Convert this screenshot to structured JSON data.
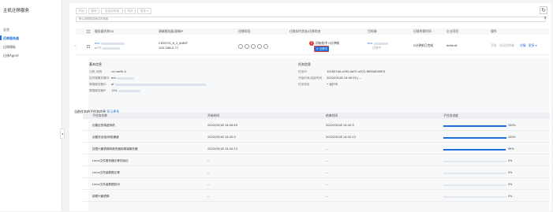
{
  "sidebar": {
    "title": "主机迁移服务",
    "items": [
      {
        "label": "总览",
        "active": false
      },
      {
        "label": "迁移服务器",
        "active": true
      },
      {
        "label": "迁移模板",
        "active": false
      },
      {
        "label": "迁移Agent",
        "active": false
      }
    ]
  },
  "toolbar": {
    "buttons": [
      "开始",
      "暂停",
      "启动目的端",
      "同步",
      "更多 ▾"
    ],
    "search_placeholder": "默认按照服务器名称搜索"
  },
  "table": {
    "headers": [
      "服务器名称/ID",
      "源端服务器/源端IP",
      "迁移阶段",
      "迁移实时状态/迁移状态",
      "目的端",
      "迁移所需时间",
      "企业项目",
      "操作"
    ],
    "row": {
      "name_prefix": "ecs",
      "name_id_prefix": "af73",
      "os": "CENTOS_6_2_64BIT",
      "ip": "192.168.0.77",
      "status": "初始化中 0分钟前",
      "status_badge": "迁移中",
      "target_prefix": "ecs",
      "target_sub": "迁移中",
      "time": "0分钟前已完成",
      "project": "default",
      "actions": [
        "开始",
        "启动目的端",
        "详情",
        "更多 ▾"
      ]
    }
  },
  "detail": {
    "basic_title": "基本信息",
    "basic": [
      {
        "k": "迁移_网络",
        "v": "cn-north-4"
      },
      {
        "k": "目的端服务器ID",
        "v": "ecs"
      },
      {
        "k": "源端服务器ID",
        "v": "af"
      },
      {
        "k": "源端服务器IP",
        "v": "124."
      }
    ],
    "task_title": "任务信息",
    "task": [
      {
        "k": "任务ID",
        "v": "101607a5-e290-4a57-a972-ff650d04f051"
      },
      {
        "k": "开始时间/结束时间",
        "v": "2022/05/18 14:40:25 | --"
      },
      {
        "k": "任务状态",
        "v": "• 运行中"
      }
    ],
    "subtask_title": "当前任务的子任务信息",
    "subtask_link": "显示更多",
    "subtask_headers": [
      "子任务名称",
      "开始时间",
      "结束时间",
      "子任务进度"
    ],
    "subtasks": [
      {
        "name": "创建目的端虚拟机",
        "start": "2022/05/18 14:40:49",
        "end": "2022/05/18 14:42:3",
        "pct": 100,
        "pct_label": "100%"
      },
      {
        "name": "创建安全组/网络通道",
        "start": "2022/05/18 14:42:3",
        "end": "2022/05/18 14:42:12",
        "pct": 100,
        "pct_label": "100%"
      },
      {
        "name": "挂载兴趣镜像和服务器到源端服务器",
        "start": "2022/05/18 14:42:13",
        "end": "--",
        "pct": 99,
        "pct_label": "99%"
      },
      {
        "name": "Linux文件服务器迁移初始化",
        "start": "--",
        "end": "--",
        "pct": 0,
        "pct_label": "0%"
      },
      {
        "name": "Linux文件级数据迁移",
        "start": "--",
        "end": "--",
        "pct": 0,
        "pct_label": "0%"
      },
      {
        "name": "Linux文件级数据校对",
        "start": "--",
        "end": "--",
        "pct": 0,
        "pct_label": "0%"
      },
      {
        "name": "卸载兴趣镜像",
        "start": "--",
        "end": "--",
        "pct": 0,
        "pct_label": "0%"
      }
    ]
  },
  "colors": {
    "accent": "#1e6fd9",
    "error": "#e23b3b"
  }
}
